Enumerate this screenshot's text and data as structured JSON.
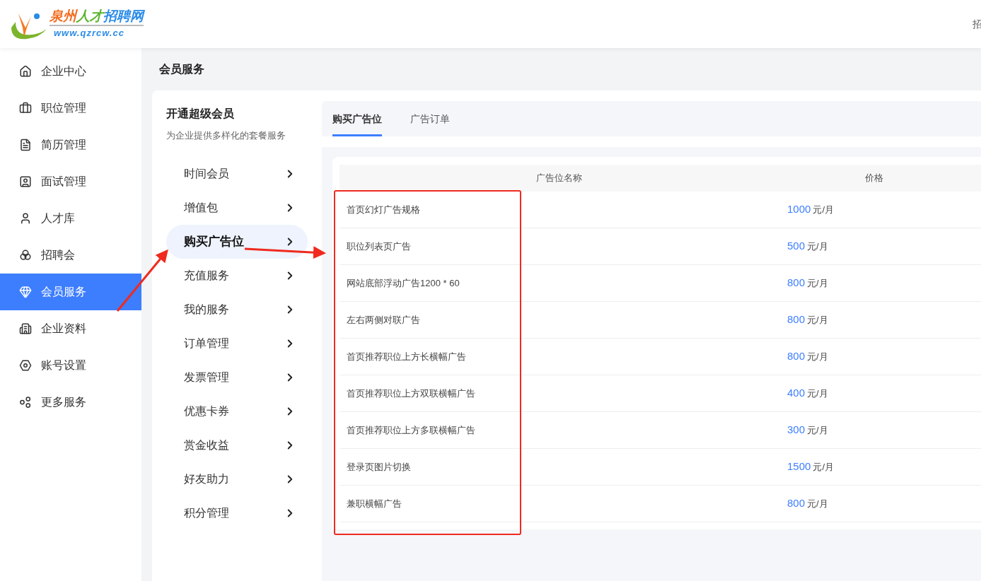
{
  "logo": {
    "title_parts": [
      {
        "text": "泉州",
        "color": "#f26b1d"
      },
      {
        "text": "人才",
        "color": "#5cb531"
      },
      {
        "text": "招聘网",
        "color": "#2a8be8"
      }
    ],
    "url": "www.qzrcw.cc"
  },
  "header": {
    "user_text": "招"
  },
  "sidebar": {
    "items": [
      {
        "label": "企业中心",
        "selected": false
      },
      {
        "label": "职位管理",
        "selected": false
      },
      {
        "label": "简历管理",
        "selected": false
      },
      {
        "label": "面试管理",
        "selected": false
      },
      {
        "label": "人才库",
        "selected": false
      },
      {
        "label": "招聘会",
        "selected": false
      },
      {
        "label": "会员服务",
        "selected": true
      },
      {
        "label": "企业资料",
        "selected": false
      },
      {
        "label": "账号设置",
        "selected": false
      },
      {
        "label": "更多服务",
        "selected": false
      }
    ]
  },
  "page_title": "会员服务",
  "submenu": {
    "title": "开通超级会员",
    "subtitle": "为企业提供多样化的套餐服务",
    "items": [
      {
        "label": "时间会员",
        "selected": false
      },
      {
        "label": "增值包",
        "selected": false
      },
      {
        "label": "购买广告位",
        "selected": true
      },
      {
        "label": "充值服务",
        "selected": false
      },
      {
        "label": "我的服务",
        "selected": false
      },
      {
        "label": "订单管理",
        "selected": false
      },
      {
        "label": "发票管理",
        "selected": false
      },
      {
        "label": "优惠卡券",
        "selected": false
      },
      {
        "label": "赏金收益",
        "selected": false
      },
      {
        "label": "好友助力",
        "selected": false
      },
      {
        "label": "积分管理",
        "selected": false
      }
    ]
  },
  "tabs": [
    {
      "label": "购买广告位",
      "selected": true
    },
    {
      "label": "广告订单",
      "selected": false
    }
  ],
  "table": {
    "columns": [
      "广告位名称",
      "价格"
    ],
    "rows": [
      {
        "name": "首页幻灯广告规格",
        "price": "1000",
        "unit": "元/月"
      },
      {
        "name": "职位列表页广告",
        "price": "500",
        "unit": "元/月"
      },
      {
        "name": "网站底部浮动广告1200 * 60",
        "price": "800",
        "unit": "元/月"
      },
      {
        "name": "左右两侧对联广告",
        "price": "800",
        "unit": "元/月"
      },
      {
        "name": "首页推荐职位上方长横幅广告",
        "price": "800",
        "unit": "元/月"
      },
      {
        "name": "首页推荐职位上方双联横幅广告",
        "price": "400",
        "unit": "元/月"
      },
      {
        "name": "首页推荐职位上方多联横幅广告",
        "price": "300",
        "unit": "元/月"
      },
      {
        "name": "登录页图片切换",
        "price": "1500",
        "unit": "元/月"
      },
      {
        "name": "兼职横幅广告",
        "price": "800",
        "unit": "元/月"
      }
    ]
  }
}
